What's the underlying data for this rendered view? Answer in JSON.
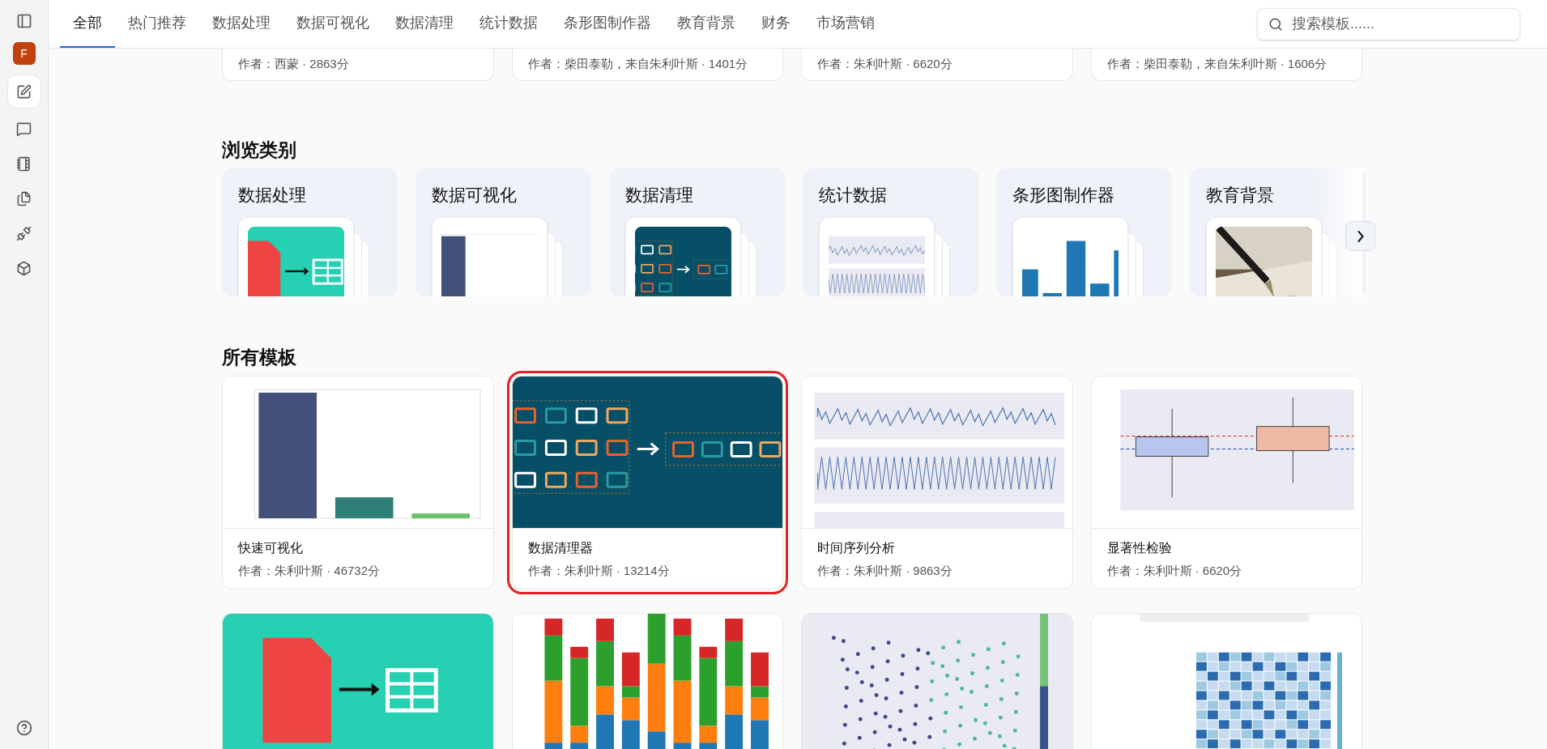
{
  "sidebar": {
    "avatar": "F",
    "items": [
      {
        "kind": "edit",
        "selected": true
      },
      {
        "kind": "chat",
        "selected": false
      },
      {
        "kind": "notebook",
        "selected": false
      },
      {
        "kind": "files",
        "selected": false
      },
      {
        "kind": "plug",
        "selected": false
      },
      {
        "kind": "box",
        "selected": false
      }
    ]
  },
  "tabs": [
    {
      "label": "全部",
      "selected": true
    },
    {
      "label": "热门推荐",
      "selected": false
    },
    {
      "label": "数据处理",
      "selected": false
    },
    {
      "label": "数据可视化",
      "selected": false
    },
    {
      "label": "数据清理",
      "selected": false
    },
    {
      "label": "统计数据",
      "selected": false
    },
    {
      "label": "条形图制作器",
      "selected": false
    },
    {
      "label": "教育背景",
      "selected": false
    },
    {
      "label": "财务",
      "selected": false
    },
    {
      "label": "市场营销",
      "selected": false
    }
  ],
  "search": {
    "placeholder": "搜索模板......"
  },
  "top_cards": [
    {
      "byline": "作者：西蒙 · 2863分"
    },
    {
      "byline": "作者：柴田泰勒，来自朱利叶斯 · 1401分"
    },
    {
      "byline": "作者：朱利叶斯 · 6620分"
    },
    {
      "byline": "作者：柴田泰勒，来自朱利叶斯 · 1606分"
    }
  ],
  "categories_heading": "浏览类别",
  "categories": [
    {
      "title": "数据处理",
      "kind": "pdf"
    },
    {
      "title": "数据可视化",
      "kind": "bar"
    },
    {
      "title": "数据清理",
      "kind": "folders"
    },
    {
      "title": "统计数据",
      "kind": "timeseries"
    },
    {
      "title": "条形图制作器",
      "kind": "bluebar"
    },
    {
      "title": "教育背景"
    }
  ],
  "templates_heading": "所有模板",
  "templates": [
    {
      "title": "快速可视化",
      "byline": "作者：朱利叶斯 · 46732分",
      "kind": "bar",
      "selected": false
    },
    {
      "title": "数据清理器",
      "byline": "作者：朱利叶斯 · 13214分",
      "kind": "folders",
      "selected": true
    },
    {
      "title": "时间序列分析",
      "byline": "作者：朱利叶斯 · 9863分",
      "kind": "timeseries",
      "selected": false
    },
    {
      "title": "显著性检验",
      "byline": "作者：朱利叶斯 · 6620分",
      "kind": "boxplot",
      "selected": false
    },
    {
      "kind": "pdf",
      "selected": false
    },
    {
      "kind": "stacked",
      "selected": false
    },
    {
      "kind": "scatter",
      "selected": false
    },
    {
      "kind": "heatmap",
      "selected": false
    }
  ]
}
